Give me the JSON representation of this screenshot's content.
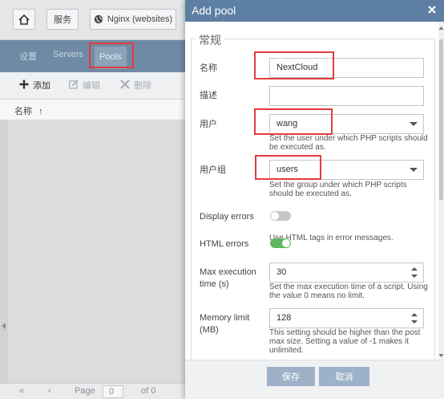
{
  "toolbar": {
    "home_icon": "home-icon",
    "services_label": "服务",
    "nginx_icon": "globe-icon",
    "nginx_label": "Nginx (websites)"
  },
  "tabs": [
    {
      "label": "设置"
    },
    {
      "label": "Servers"
    },
    {
      "label": "Pools",
      "active": true
    }
  ],
  "actions": {
    "add_label": "添加",
    "edit_label": "编辑",
    "delete_label": "删除"
  },
  "grid": {
    "column_name": "名称",
    "sort_indicator": "↑"
  },
  "pager": {
    "page_label": "Page",
    "page_value": "0",
    "of_label": "of 0"
  },
  "dialog": {
    "title": "Add pool",
    "close_icon": "close-icon",
    "section_title": "常规",
    "fields": {
      "name": {
        "label": "名称",
        "value": "NextCloud"
      },
      "description": {
        "label": "描述",
        "value": ""
      },
      "user": {
        "label": "用户",
        "value": "wang",
        "hint": "Set the user under which PHP scripts should be executed as."
      },
      "group": {
        "label": "用户组",
        "value": "users",
        "hint": "Set the group under which PHP scripts should be executed as."
      },
      "display_errors": {
        "label": "Display errors",
        "enabled": false
      },
      "html_errors": {
        "label": "HTML errors",
        "enabled": true,
        "hint": "Use HTML tags in error messages."
      },
      "max_execution_time": {
        "label": "Max execution time (s)",
        "value": "30",
        "hint": "Set the max execution time of a script. Using the value 0 means no limit."
      },
      "memory_limit": {
        "label": "Memory limit (MB)",
        "value": "128",
        "hint": "This setting should be higher than the post max size. Setting a value of -1 makes it unlimited."
      }
    },
    "save_label": "保存",
    "cancel_label": "取消"
  },
  "colors": {
    "header": "#5d7fa3",
    "tabbar": "#6f8aa5",
    "highlight": "#e53b3b",
    "toggle_on": "#5cb85c",
    "button": "#9db2c8"
  }
}
